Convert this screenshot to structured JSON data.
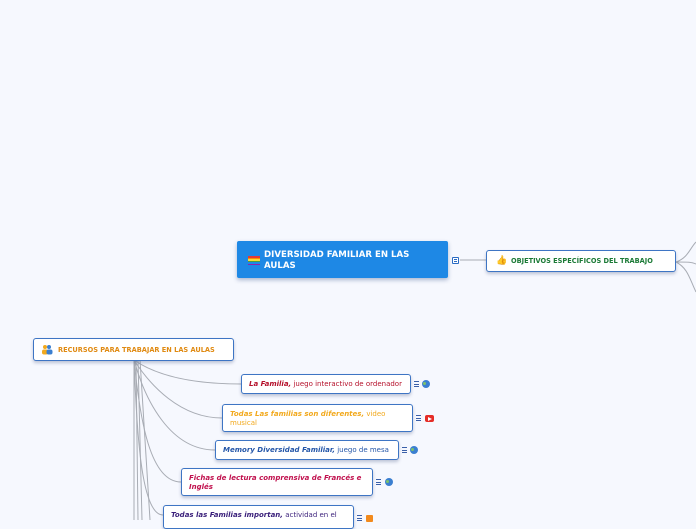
{
  "colors": {
    "background": "#f6f8fe",
    "root_fill": "#1e88e5",
    "node_border": "#3e75c4",
    "connector": "#a8acb4",
    "objetivos_text": "#1b7a36",
    "recursos_text": "#e08a12"
  },
  "root": {
    "label": "DIVERSIDAD FAMILIAR EN LAS AULAS",
    "icon": "rainbow-flag-icon"
  },
  "objetivos": {
    "label": "OBJETIVOS ESPECÍFICOS DEL TRABAJO",
    "icon": "thumbs-up-icon"
  },
  "recursos": {
    "label": "RECURSOS PARA TRABAJAR EN LAS AULAS",
    "icon": "people-group-icon"
  },
  "resources": [
    {
      "title": "La Familia,",
      "desc": "juego interactivo de ordenador",
      "title_color": "#b5102a",
      "desc_color": "#b5102a",
      "link": "globe-icon"
    },
    {
      "title": "Todas Las familias son diferentes,",
      "desc": "video musical",
      "title_color": "#f2a91d",
      "desc_color": "#f2a91d",
      "link": "youtube-icon"
    },
    {
      "title": "Memory Diversidad Familiar,",
      "desc": "juego de mesa",
      "title_color": "#2456a8",
      "desc_color": "#2456a8",
      "link": "globe-icon"
    },
    {
      "title": "Fichas de lectura comprensiva de Francés e Inglés",
      "desc": "",
      "title_color": "#c0104d",
      "desc_color": "#c0104d",
      "link": "globe-icon"
    },
    {
      "title": "Todas las Familias importan,",
      "desc": "actividad en el",
      "title_color": "#3a1f7a",
      "desc_color": "#3a1f7a",
      "link": "rss-icon"
    }
  ]
}
